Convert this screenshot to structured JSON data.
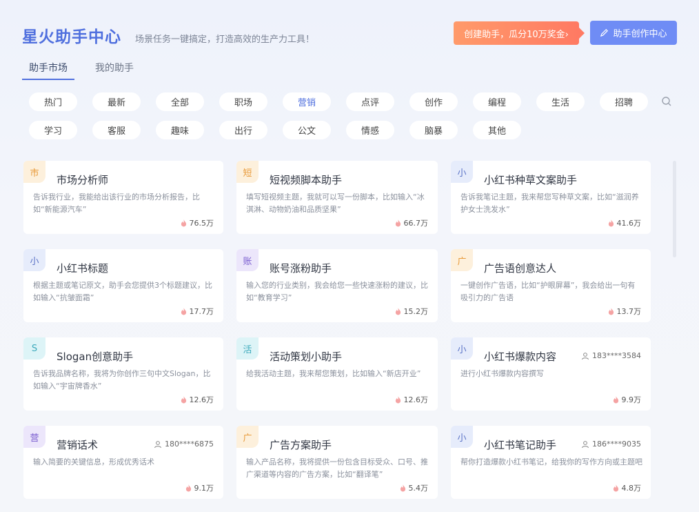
{
  "header": {
    "brand": "星火助手中心",
    "tagline": "场景任务一键搞定，打造高效的生产力工具！",
    "promo_label": "创建助手，瓜分10万奖金›",
    "create_label": "助手创作中心"
  },
  "tabs": [
    "助手市场",
    "我的助手"
  ],
  "categories": {
    "row1": [
      "热门",
      "最新",
      "全部",
      "职场",
      "营销",
      "点评",
      "创作",
      "编程",
      "生活",
      "招聘"
    ],
    "row2": [
      "学习",
      "客服",
      "趣味",
      "出行",
      "公文",
      "情感",
      "脑暴",
      "其他"
    ],
    "active": "营销"
  },
  "cards": [
    {
      "badge": "市",
      "title": "市场分析师",
      "desc": "告诉我行业，我能给出该行业的市场分析报告，比如“新能源汽车”",
      "count": "76.5万"
    },
    {
      "badge": "短",
      "title": "短视频脚本助手",
      "desc": "填写短视频主题，我就可以写一份脚本，比如输入“冰淇淋、动物奶油和品质坚果”",
      "count": "66.7万"
    },
    {
      "badge": "小",
      "title": "小红书种草文案助手",
      "desc": "告诉我笔记主题，我来帮您写种草文案，比如“滋润养护女士洗发水”",
      "count": "41.6万"
    },
    {
      "badge": "小",
      "title": "小红书标题",
      "desc": "根据主题或笔记原文，助手会您提供3个标题建议，比如输入“抗皱面霜”",
      "count": "17.7万"
    },
    {
      "badge": "账",
      "title": "账号涨粉助手",
      "desc": "输入您的行业类别，我会给您一些快速涨粉的建议，比如“教育学习”",
      "count": "15.2万"
    },
    {
      "badge": "广",
      "title": "广告语创意达人",
      "desc": "一键创作广告语，比如“护眼屏幕”，我会给出一句有吸引力的广告语",
      "count": "13.7万"
    },
    {
      "badge": "S",
      "title": "Slogan创意助手",
      "desc": "告诉我品牌名称，我将为你创作三句中文Slogan，比如输入“宇宙牌香水”",
      "count": "12.6万"
    },
    {
      "badge": "活",
      "title": "活动策划小助手",
      "desc": "给我活动主题，我来帮您策划，比如输入“新店开业”",
      "count": "12.6万"
    },
    {
      "badge": "小",
      "title": "小红书爆款内容",
      "desc": "进行小红书爆款内容撰写",
      "count": "9.9万",
      "author": "183****3584"
    },
    {
      "badge": "营",
      "title": "营销话术",
      "desc": "输入简要的关键信息，形成优秀话术",
      "count": "9.1万",
      "author": "180****6875"
    },
    {
      "badge": "广",
      "title": "广告方案助手",
      "desc": "输入产品名称，我将提供一份包含目标受众、口号、推广渠道等内容的广告方案，比如“翻译笔”",
      "count": "5.4万"
    },
    {
      "badge": "小",
      "title": "小红书笔记助手",
      "desc": "帮你打造爆款小红书笔记，给我你的写作方向或主题吧",
      "count": "4.8万",
      "author": "186****9035"
    }
  ],
  "icons": {
    "promo_arrow": "chevron-right-icon",
    "create": "pencil-icon",
    "search": "search-icon",
    "hot": "flame-icon",
    "author": "user-icon"
  },
  "colors": {
    "brand": "#4f6fde",
    "promo": "#ff7a63",
    "create": "#6f8cf5",
    "hot": "#f59a9a"
  }
}
